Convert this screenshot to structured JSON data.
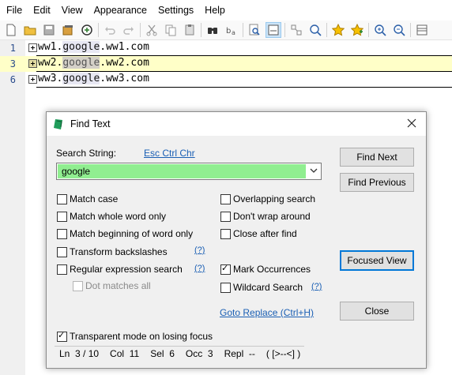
{
  "menu": [
    "File",
    "Edit",
    "View",
    "Appearance",
    "Settings",
    "Help"
  ],
  "toolbar_icons": [
    "new-file-icon",
    "open-folder-icon",
    "save-icon",
    "save-all-icon",
    "reload-icon",
    "undo-icon",
    "redo-icon",
    "cut-icon",
    "copy-icon",
    "paste-icon",
    "find-icon",
    "replace-icon",
    "find-in-files-icon",
    "view-icon",
    "goto-icon",
    "zoom-icon",
    "bookmark-icon",
    "bookmark-add-icon",
    "zoom-in-icon",
    "zoom-out-icon",
    "panel-icon"
  ],
  "editor": {
    "lines": [
      {
        "num": "1",
        "pre": "ww1.",
        "match": "google",
        "post": ".ww1.com",
        "current": false
      },
      {
        "num": "3",
        "pre": "ww2.",
        "match": "google",
        "post": ".ww2.com",
        "current": true
      },
      {
        "num": "6",
        "pre": "ww3.",
        "match": "google",
        "post": ".ww3.com",
        "current": false
      }
    ]
  },
  "dialog": {
    "title": "Find Text",
    "search_label": "Search String:",
    "esc_link": "Esc Ctrl Chr",
    "search_value": "google",
    "options_left": [
      {
        "label": "Match case",
        "checked": false
      },
      {
        "label": "Match whole word only",
        "checked": false
      },
      {
        "label": "Match beginning of word only",
        "checked": false
      },
      {
        "label": "Transform backslashes",
        "checked": false
      },
      {
        "label": "Regular expression search",
        "checked": false
      }
    ],
    "dot_matches": {
      "label": "Dot matches all",
      "checked": false
    },
    "help_marker": "(?)",
    "options_right": [
      {
        "label": "Overlapping search",
        "checked": false
      },
      {
        "label": "Don't wrap around",
        "checked": false
      },
      {
        "label": "Close after find",
        "checked": false
      },
      {
        "label": "Mark Occurrences",
        "checked": true
      },
      {
        "label": "Wildcard Search",
        "checked": false
      }
    ],
    "goto_replace": "Goto Replace (Ctrl+H)",
    "transparent_mode": {
      "label": "Transparent mode on losing focus",
      "checked": true
    },
    "buttons": {
      "find_next": "Find Next",
      "find_previous": "Find Previous",
      "focused_view": "Focused View",
      "close": "Close"
    },
    "status": {
      "ln": "Ln  3 / 10",
      "col": "Col  11",
      "sel": "Sel  6",
      "occ": "Occ  3",
      "repl": "Repl  --",
      "extra": "( [>--<] )"
    }
  }
}
